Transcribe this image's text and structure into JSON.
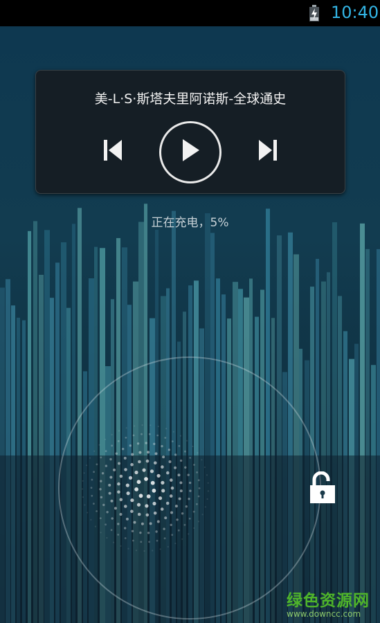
{
  "status_bar": {
    "time": "10:40",
    "battery_icon": "battery-charging-icon"
  },
  "music": {
    "track_title": "美-L·S·斯塔夫里阿诺斯-全球通史",
    "controls": {
      "prev_icon": "skip-previous-icon",
      "play_icon": "play-icon",
      "next_icon": "skip-next-icon"
    }
  },
  "charging": {
    "text": "正在充电，5%"
  },
  "unlock": {
    "icon": "unlock-icon"
  },
  "watermark": {
    "main": "绿色资源网",
    "url": "www.downcc.com"
  },
  "colors": {
    "clock": "#33b5e5",
    "watermark": "#4fb52a"
  }
}
